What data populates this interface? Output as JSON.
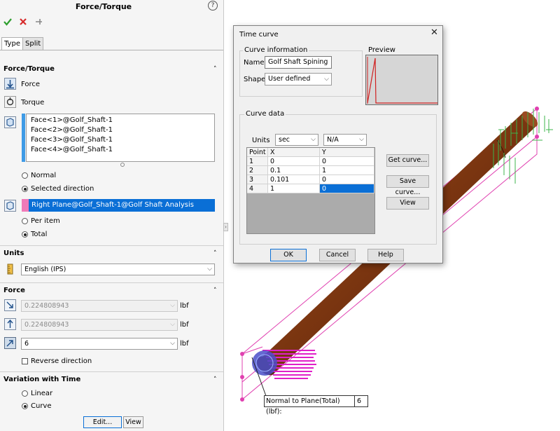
{
  "panel": {
    "title": "Force/Torque",
    "help": "?",
    "tabs": [
      "Type",
      "Split"
    ],
    "force_torque": {
      "header": "Force/Torque",
      "force_label": "Force",
      "torque_label": "Torque",
      "faces": [
        "Face<1>@Golf_Shaft-1",
        "Face<2>@Golf_Shaft-1",
        "Face<3>@Golf_Shaft-1",
        "Face<4>@Golf_Shaft-1"
      ],
      "normal_label": "Normal",
      "selected_direction_label": "Selected direction",
      "direction_ref": "Right Plane@Golf_Shaft-1@Golf Shaft Analysis",
      "per_item_label": "Per item",
      "total_label": "Total"
    },
    "units": {
      "header": "Units",
      "value": "English (IPS)"
    },
    "force": {
      "header": "Force",
      "value1": "0.224808943",
      "value2": "0.224808943",
      "value3": "6",
      "unit": "lbf",
      "reverse_label": "Reverse direction"
    },
    "variation": {
      "header": "Variation with Time",
      "linear_label": "Linear",
      "curve_label": "Curve",
      "edit_label": "Edit...",
      "view_label": "View"
    }
  },
  "dialog": {
    "title": "Time curve",
    "curve_info_label": "Curve information",
    "name_label": "Name",
    "name_value": "Golf Shaft Spining",
    "shape_label": "Shape",
    "shape_value": "User defined",
    "preview_label": "Preview",
    "curve_data_label": "Curve data",
    "units_label": "Units",
    "units_x": "sec",
    "units_y": "N/A",
    "table": {
      "headers": [
        "Point",
        "X",
        "Y"
      ],
      "rows": [
        {
          "point": "1",
          "x": "0",
          "y": "0"
        },
        {
          "point": "2",
          "x": "0.1",
          "y": "1"
        },
        {
          "point": "3",
          "x": "0.101",
          "y": "0"
        },
        {
          "point": "4",
          "x": "1",
          "y": "0"
        }
      ]
    },
    "get_curve_label": "Get curve...",
    "save_curve_label": "Save curve...",
    "view_label": "View",
    "ok_label": "OK",
    "cancel_label": "Cancel",
    "help_label": "Help"
  },
  "callout": {
    "label": "Normal to Plane(Total) (lbf):",
    "value": "6"
  },
  "colors": {
    "shaft": "#7a3510",
    "selection": "#e040b0",
    "arrows": "#3cb44b",
    "accent": "#0a6fd6",
    "face_list_bar": "#3f9be6",
    "direction_bar": "#f07ab8"
  }
}
